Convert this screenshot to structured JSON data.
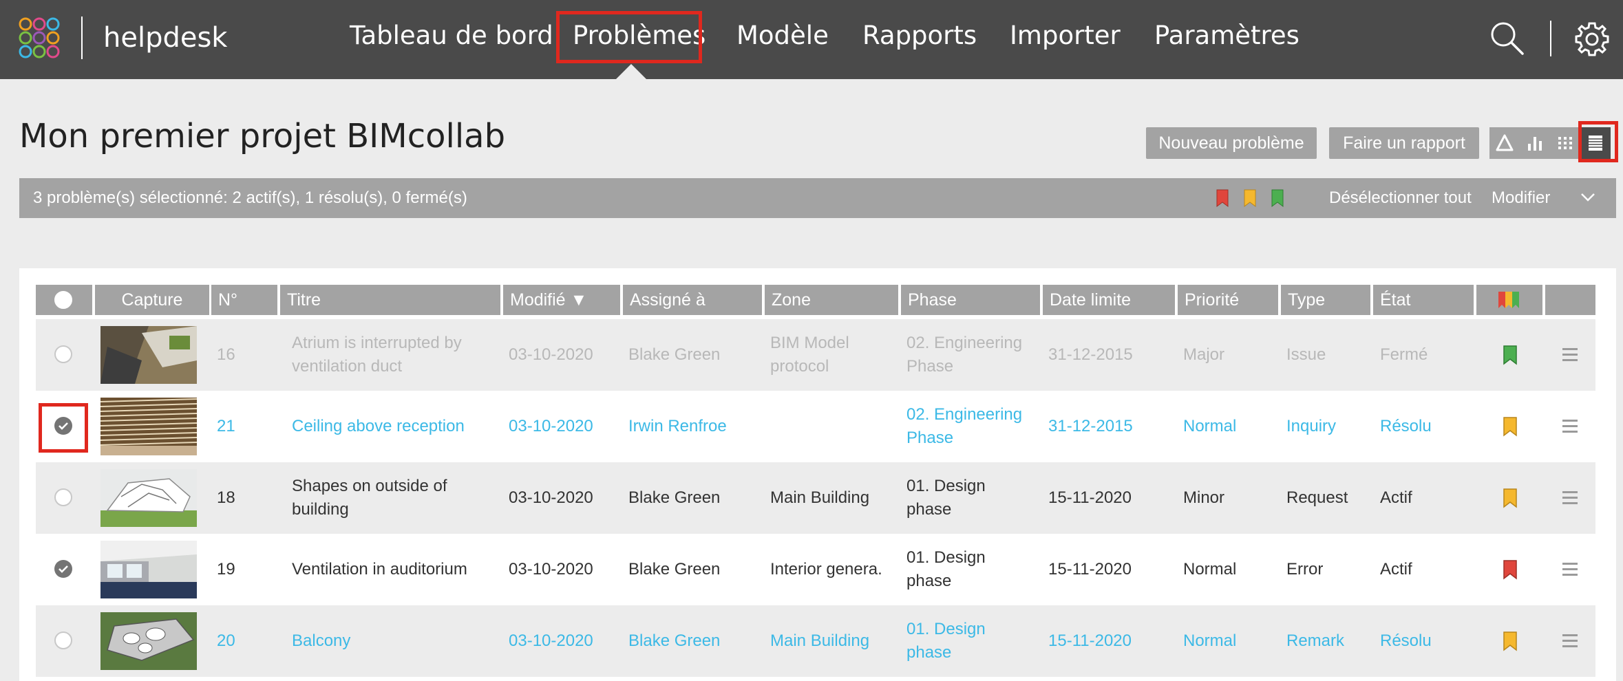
{
  "header": {
    "brand": "helpdesk",
    "nav": [
      "Tableau de bord",
      "Problèmes",
      "Modèle",
      "Rapports",
      "Importer",
      "Paramètres"
    ],
    "active_nav": "Problèmes"
  },
  "page": {
    "title": "Mon premier projet BIMcollab",
    "new_issue_label": "Nouveau problème",
    "report_label": "Faire un rapport"
  },
  "selection": {
    "summary": "3 problème(s) sélectionné: 2 actif(s), 1 résolu(s), 0 fermé(s)",
    "deselect_label": "Désélectionner tout",
    "modify_label": "Modifier"
  },
  "table": {
    "headers": {
      "capture": "Capture",
      "num": "N°",
      "title": "Titre",
      "modified": "Modifié ▼",
      "assigned": "Assigné à",
      "zone": "Zone",
      "phase": "Phase",
      "deadline": "Date limite",
      "priority": "Priorité",
      "type": "Type",
      "status": "État"
    },
    "rows": [
      {
        "num": "16",
        "title": [
          "Atrium is interrupted by",
          "ventilation duct"
        ],
        "modified": "03-10-2020",
        "assigned": "Blake Green",
        "zone": [
          "BIM Model",
          "protocol"
        ],
        "phase": [
          "02. Engineering",
          "Phase"
        ],
        "deadline": "31-12-2015",
        "priority": "Major",
        "type": "Issue",
        "status": "Fermé",
        "state": "closed",
        "selected": false,
        "flag": "green"
      },
      {
        "num": "21",
        "title": [
          "Ceiling above reception"
        ],
        "modified": "03-10-2020",
        "assigned": "Irwin Renfroe",
        "zone": [],
        "phase": [
          "02. Engineering",
          "Phase"
        ],
        "deadline": "31-12-2015",
        "priority": "Normal",
        "type": "Inquiry",
        "status": "Résolu",
        "state": "resolved",
        "selected": true,
        "flag": "yellow"
      },
      {
        "num": "18",
        "title": [
          "Shapes on outside of",
          "building"
        ],
        "modified": "03-10-2020",
        "assigned": "Blake Green",
        "zone": [
          "Main Building"
        ],
        "phase": [
          "01. Design",
          "phase"
        ],
        "deadline": "15-11-2020",
        "priority": "Minor",
        "type": "Request",
        "status": "Actif",
        "state": "active",
        "selected": false,
        "flag": "yellow"
      },
      {
        "num": "19",
        "title": [
          "Ventilation in auditorium"
        ],
        "modified": "03-10-2020",
        "assigned": "Blake Green",
        "zone": [
          "Interior genera."
        ],
        "phase": [
          "01. Design",
          "phase"
        ],
        "deadline": "15-11-2020",
        "priority": "Normal",
        "type": "Error",
        "status": "Actif",
        "state": "active",
        "selected": true,
        "flag": "red"
      },
      {
        "num": "20",
        "title": [
          "Balcony"
        ],
        "modified": "03-10-2020",
        "assigned": "Blake Green",
        "zone": [
          "Main Building"
        ],
        "phase": [
          "01. Design",
          "phase"
        ],
        "deadline": "15-11-2020",
        "priority": "Normal",
        "type": "Remark",
        "status": "Résolu",
        "state": "resolved",
        "selected": false,
        "flag": "yellow"
      }
    ]
  },
  "colors": {
    "topbar": "#4a4a4a",
    "highlight": "#e0281e",
    "resolved_text": "#3cb9e6",
    "closed_text": "#b8b8b8",
    "active_text": "#333333",
    "flag_red": "#e0463c",
    "flag_yellow": "#f5b82e",
    "flag_green": "#4caf50"
  }
}
